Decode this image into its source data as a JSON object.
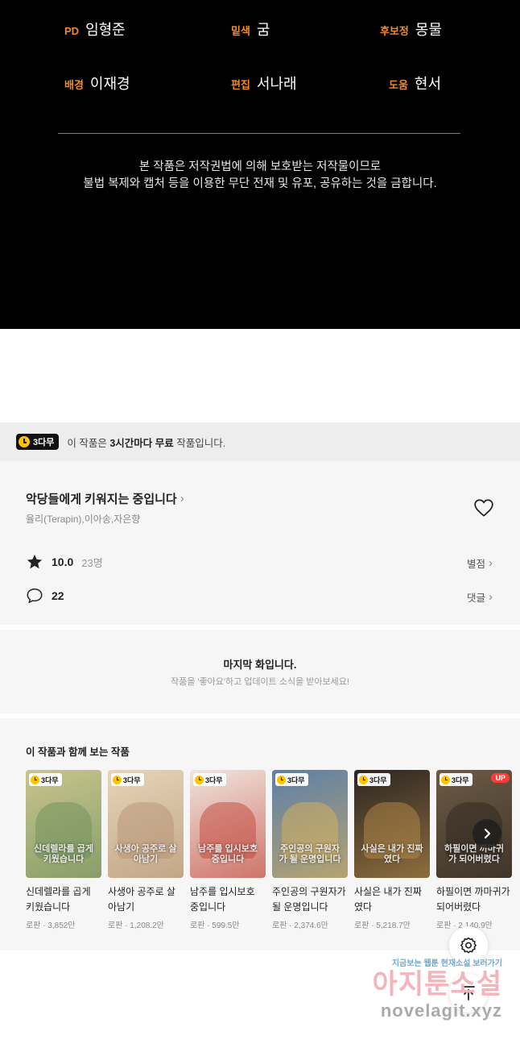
{
  "credits": {
    "items": [
      {
        "role": "PD",
        "name": "임형준"
      },
      {
        "role": "밑색",
        "name": "굼"
      },
      {
        "role": "후보정",
        "name": "몽물"
      },
      {
        "role": "배경",
        "name": "이재경"
      },
      {
        "role": "편집",
        "name": "서나래"
      },
      {
        "role": "도움",
        "name": "현서"
      }
    ],
    "notice_line1": "본 작품은 저작권법에 의해 보호받는 저작물이므로",
    "notice_line2": "불법 복제와 캡처 등을 이용한 무단 전재 및 유포, 공유하는 것을 금합니다."
  },
  "free_banner": {
    "badge": "3다무",
    "text_prefix": "이 작품은 ",
    "text_bold": "3시간마다 무료",
    "text_suffix": " 작품입니다."
  },
  "work": {
    "title": "악당들에게 키워지는 중입니다",
    "authors": "율리(Terapin),이아송,자은향",
    "rating": "10.0",
    "rating_count": "23명",
    "rating_link": "별점",
    "comments": "22",
    "comments_link": "댓글"
  },
  "last_episode": {
    "title": "마지막 화입니다.",
    "subtitle": "작품을 '좋아요'하고 업데이트 소식을 받아보세요!"
  },
  "recommendations": {
    "heading": "이 작품과 함께 보는 작품",
    "badge": "3다무",
    "up_label": "UP",
    "items": [
      {
        "title": "신데렐라를 곱게 키웠습니다",
        "meta": "로판 · 3,852만",
        "cover_text": "신데렐라를 곱게 키웠습니다",
        "bg": "#c9c48e",
        "art": "#6d8f5a"
      },
      {
        "title": "사생아 공주로 살아남기",
        "meta": "로판 · 1,208.2만",
        "cover_text": "사생아 공주로 살아남기",
        "bg": "#e6d4b8",
        "art": "#b59473"
      },
      {
        "title": "남주를 입시보호 중입니다",
        "meta": "로판 · 599.5만",
        "cover_text": "남주를 입시보호 중입니다",
        "bg": "#f0e6de",
        "art": "#c2463a"
      },
      {
        "title": "주인공의 구원자가 될 운명입니다",
        "meta": "로판 · 2,374.6만",
        "cover_text": "주인공의 구원자가 될 운명입니다",
        "bg": "#5d7fa8",
        "art": "#d9b25a"
      },
      {
        "title": "사실은 내가 진짜였다",
        "meta": "로판 · 5,218.7만",
        "cover_text": "사실은 내가 진짜였다",
        "bg": "#2b2521",
        "art": "#b58b4a"
      },
      {
        "title": "하필이면 까마귀가 되어버렸다",
        "meta": "로판 · 2,140.9만",
        "cover_text": "하필이면 까마귀가 되어버렸다",
        "bg": "#6b5a45",
        "art": "#2e261e"
      }
    ]
  },
  "watermark": {
    "top": "지금보는 웹툰 현재소설 보러가기",
    "mid": "아지툰소설",
    "bottom": "novelagit.xyz"
  },
  "colors": {
    "accent_orange": "#f08a2a",
    "badge_yellow": "#ffc400",
    "up_red": "#ff3a3a"
  }
}
